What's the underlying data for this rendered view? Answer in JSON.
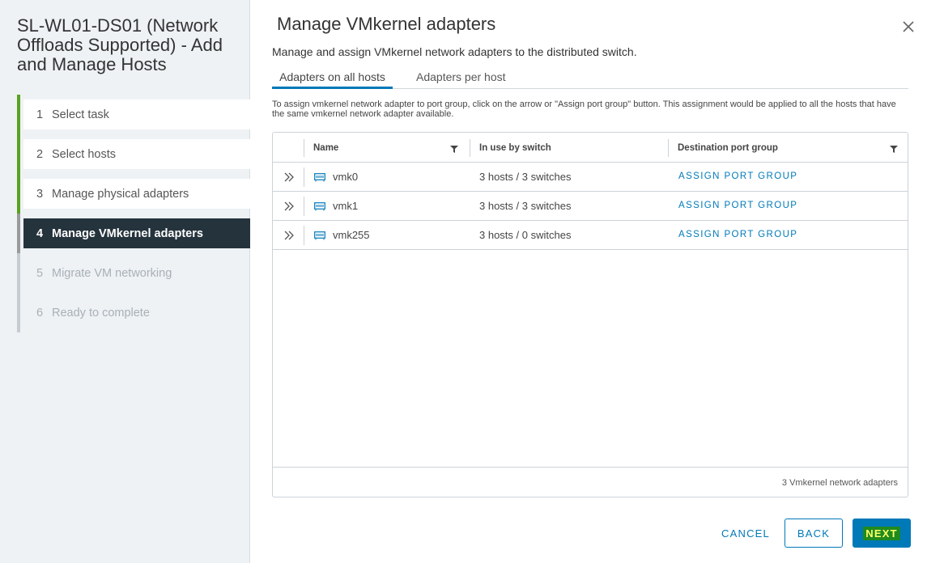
{
  "wizard": {
    "title": "SL-WL01-DS01 (Network Offloads Supported) - Add and Manage Hosts",
    "steps": [
      {
        "num": "1",
        "label": "Select task",
        "state": "done"
      },
      {
        "num": "2",
        "label": "Select hosts",
        "state": "done"
      },
      {
        "num": "3",
        "label": "Manage physical adapters",
        "state": "done"
      },
      {
        "num": "4",
        "label": "Manage VMkernel adapters",
        "state": "active"
      },
      {
        "num": "5",
        "label": "Migrate VM networking",
        "state": "todo"
      },
      {
        "num": "6",
        "label": "Ready to complete",
        "state": "todo"
      }
    ]
  },
  "main": {
    "title": "Manage VMkernel adapters",
    "subtitle": "Manage and assign VMkernel network adapters to the distributed switch.",
    "tabs": [
      {
        "label": "Adapters on all hosts",
        "selected": true
      },
      {
        "label": "Adapters per host",
        "selected": false
      }
    ],
    "hint": "To assign vmkernel network adapter to port group, click on the arrow or \"Assign port group\" button. This assignment would be applied to all the hosts that have the same vmkernel network adapter available."
  },
  "grid": {
    "columns": [
      "Name",
      "In use by switch",
      "Destination port group"
    ],
    "rows": [
      {
        "name": "vmk0",
        "in_use": "3 hosts / 3 switches",
        "action": "ASSIGN PORT GROUP"
      },
      {
        "name": "vmk1",
        "in_use": "3 hosts / 3 switches",
        "action": "ASSIGN PORT GROUP"
      },
      {
        "name": "vmk255",
        "in_use": "3 hosts / 0 switches",
        "action": "ASSIGN PORT GROUP"
      }
    ],
    "footer": "3 Vmkernel network adapters"
  },
  "buttons": {
    "cancel": "CANCEL",
    "back": "BACK",
    "next": "NEXT"
  },
  "colors": {
    "accent": "#0079b8",
    "done_bar": "#5aa220",
    "active_bg": "#25333d",
    "nav_bg": "#eef2f5",
    "highlight": "#1f8a1f"
  },
  "icons": {
    "close": "close-icon",
    "filter": "filter-icon",
    "expand": "double-chevron-right-icon",
    "adapter": "network-adapter-icon"
  }
}
